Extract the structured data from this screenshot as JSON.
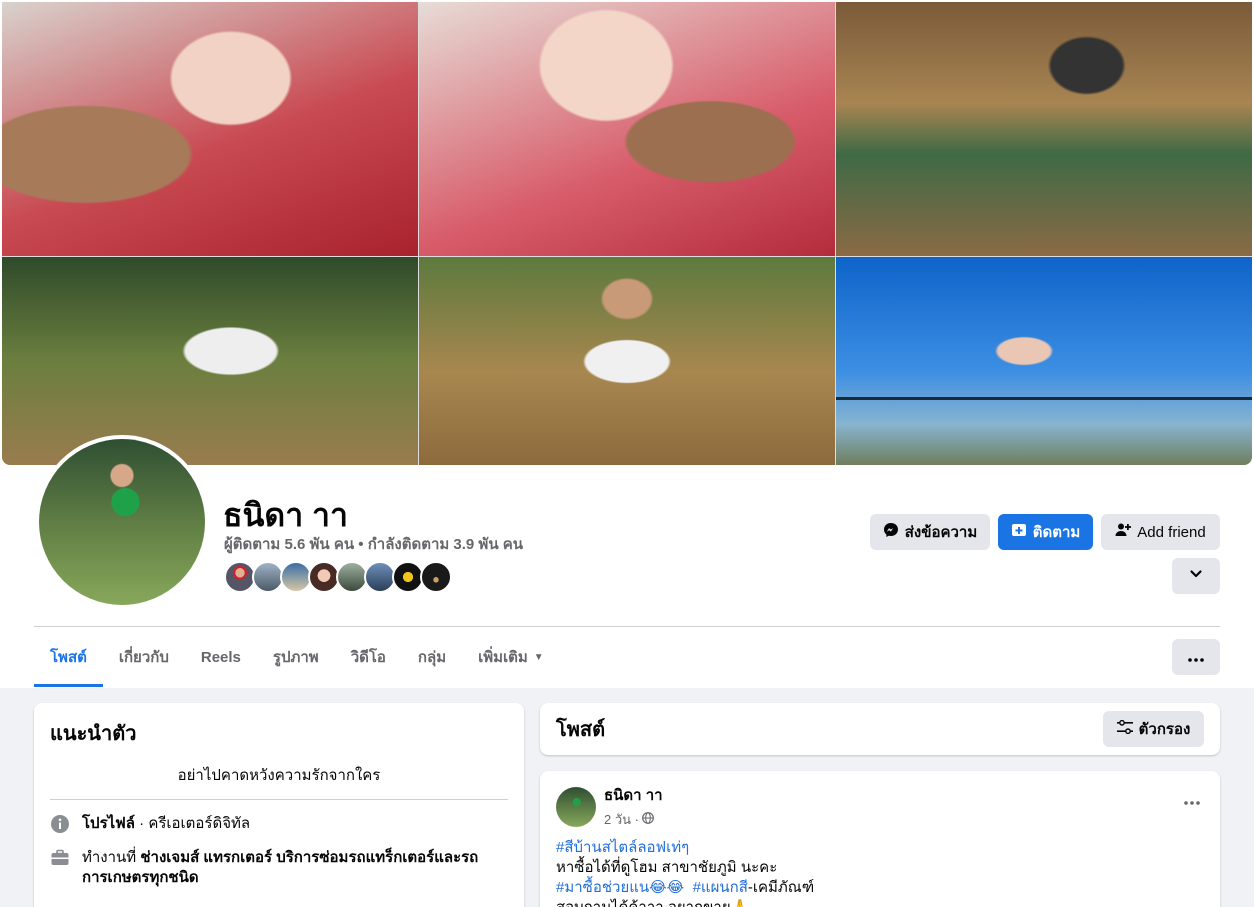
{
  "profile": {
    "name": "ธนิดา าา",
    "followers": "ผู้ติดตาม 5.6 พัน คน • กำลังติดตาม 3.9 พัน คน"
  },
  "actions": {
    "message": "ส่งข้อความ",
    "follow": "ติดตาม",
    "add_friend": "Add friend"
  },
  "tabs": [
    {
      "label": "โพสต์"
    },
    {
      "label": "เกี่ยวกับ"
    },
    {
      "label": "Reels"
    },
    {
      "label": "รูปภาพ"
    },
    {
      "label": "วิดีโอ"
    },
    {
      "label": "กลุ่ม"
    },
    {
      "label": "เพิ่มเติม"
    }
  ],
  "intro": {
    "title": "แนะนำตัว",
    "bio": "อย่าไปคาดหวังความรักจากใคร",
    "profile_label": "โปรไฟล์",
    "profile_value": " · ครีเอเตอร์ดิจิทัล",
    "work_prefix": "ทำงานที่ ",
    "work_value": "ช่างเจมส์ แทรกเตอร์ บริการซ่อมรถแทร็กเตอร์และรถการเกษตรทุกชนิด"
  },
  "posts": {
    "title": "โพสต์",
    "filter_label": "ตัวกรอง"
  },
  "post": {
    "author": "ธนิดา าา",
    "time": "2 วัน ·",
    "line1_tag": "#สีบ้านสไตล์ลอฟเท่ๆ",
    "line2": "หาซื้อได้ที่ดูโฮม สาขาชัยภูมิ นะคะ",
    "line3_tag1": "#มาซื้อช่วยแน😂😂",
    "line3_tag2": "#แผนกสี",
    "line3_rest": "-เคมีภัณฑ์",
    "line4": "สอบถามได้ค้าาา อยากขาย🙏"
  },
  "colors": {
    "accent": "#1b74e4",
    "secondary_text": "#65676b",
    "link": "#216fdb"
  }
}
